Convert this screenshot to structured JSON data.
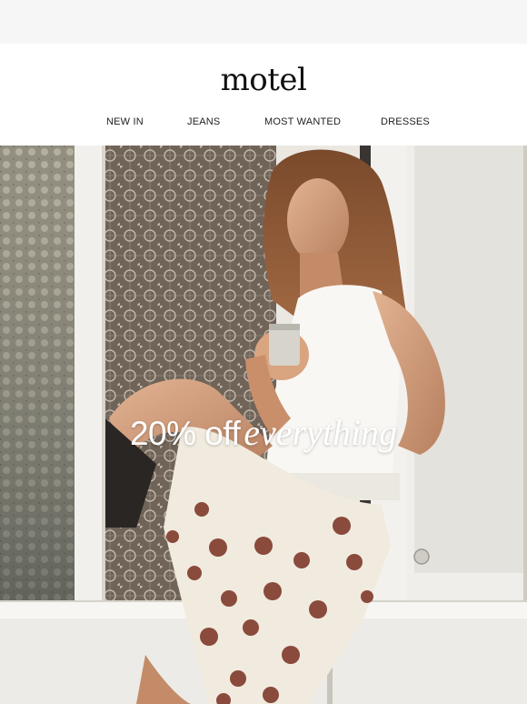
{
  "brand": {
    "logo_text": "motel"
  },
  "nav": {
    "items": [
      {
        "label": "NEW IN"
      },
      {
        "label": "JEANS"
      },
      {
        "label": "MOST WANTED"
      },
      {
        "label": "DRESSES"
      }
    ]
  },
  "hero": {
    "headline_lead": "20% off",
    "headline_emphasis": "everything",
    "image_icon": "hero-photo-woman-at-window"
  },
  "colors": {
    "page_bg": "#f6f6f6",
    "header_bg": "#ffffff",
    "text": "#111111",
    "headline": "#ffffff"
  }
}
